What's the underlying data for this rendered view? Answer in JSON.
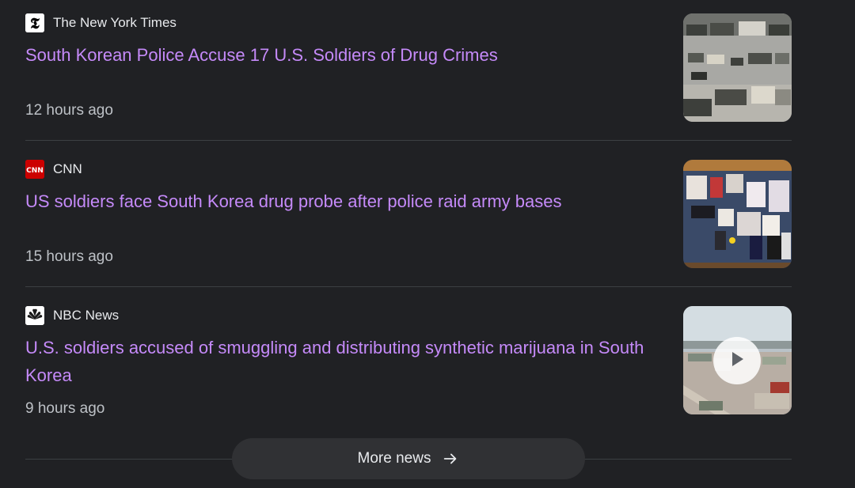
{
  "articles": [
    {
      "source": "The New York Times",
      "source_icon": "nyt-logo-icon",
      "headline": "South Korean Police Accuse 17 U.S. Soldiers of Drug Crimes",
      "time": "12 hours ago",
      "thumbnail": "military-vehicles-thumbnail"
    },
    {
      "source": "CNN",
      "source_icon": "cnn-logo-icon",
      "headline": "US soldiers face South Korea drug probe after police raid army bases",
      "time": "15 hours ago",
      "thumbnail": "seized-items-thumbnail"
    },
    {
      "source": "NBC News",
      "source_icon": "nbc-logo-icon",
      "headline": "U.S. soldiers accused of smuggling and distributing synthetic marijuana in South Korea",
      "time": "9 hours ago",
      "thumbnail": "army-base-video-thumbnail",
      "has_video": true
    }
  ],
  "more_news": {
    "label": "More news",
    "icon": "arrow-right-icon"
  },
  "colors": {
    "background": "#202124",
    "headline": "#c58af9",
    "source_text": "#e8eaed",
    "time_text": "#bdc1c6",
    "divider": "#3c4043",
    "button_bg": "#303134"
  }
}
